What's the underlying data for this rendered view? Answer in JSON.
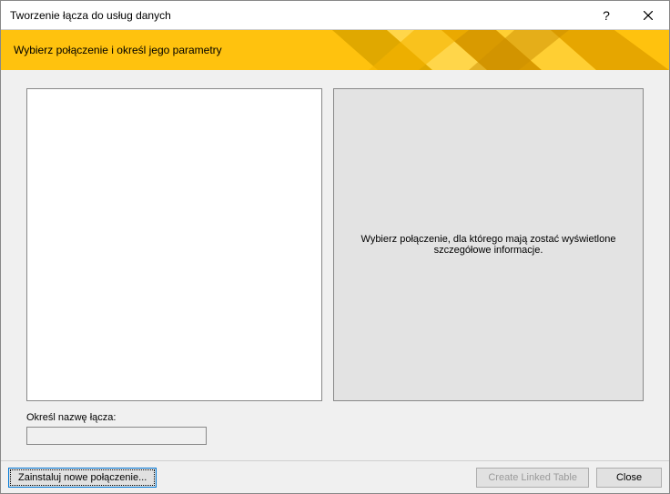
{
  "titlebar": {
    "title": "Tworzenie łącza do usług danych",
    "help": "?",
    "close_icon": "close-icon"
  },
  "header": {
    "subtitle": "Wybierz połączenie i określ jego parametry"
  },
  "right_panel": {
    "placeholder": "Wybierz połączenie, dla którego mają zostać wyświetlone szczegółowe informacje."
  },
  "name_section": {
    "label": "Określ nazwę łącza:",
    "value": ""
  },
  "footer": {
    "install_label": "Zainstaluj nowe połączenie...",
    "create_label": "Create Linked Table",
    "close_label": "Close"
  },
  "colors": {
    "accent": "#ffc20e"
  }
}
